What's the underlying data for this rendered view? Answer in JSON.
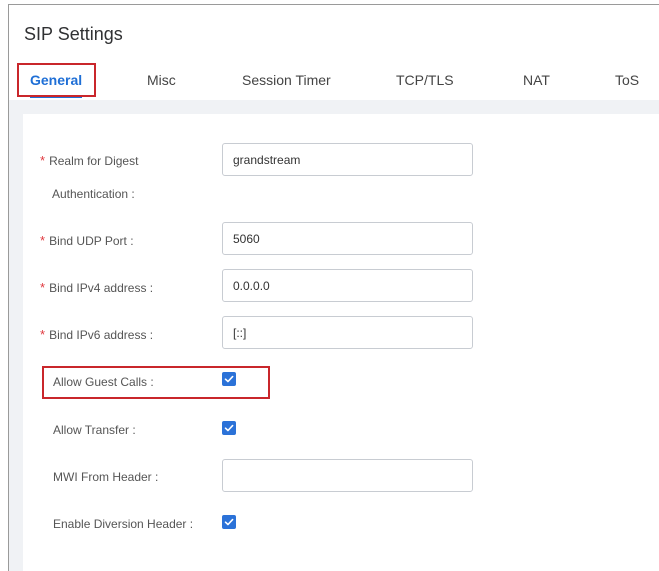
{
  "page": {
    "title": "SIP Settings"
  },
  "tabs": [
    {
      "label": "General",
      "active": true
    },
    {
      "label": "Misc",
      "active": false
    },
    {
      "label": "Session Timer",
      "active": false
    },
    {
      "label": "TCP/TLS",
      "active": false
    },
    {
      "label": "NAT",
      "active": false
    },
    {
      "label": "ToS",
      "active": false
    }
  ],
  "form": {
    "realm": {
      "label_line1": "Realm for Digest",
      "label_line2": "Authentication :",
      "value": "grandstream",
      "required": true
    },
    "udp_port": {
      "label": "Bind UDP Port :",
      "value": "5060",
      "required": true
    },
    "ipv4": {
      "label": "Bind IPv4 address :",
      "value": "0.0.0.0",
      "required": true
    },
    "ipv6": {
      "label": "Bind IPv6 address :",
      "value": "[::]",
      "required": true
    },
    "guest_calls": {
      "label": "Allow Guest Calls :",
      "checked": true
    },
    "transfer": {
      "label": "Allow Transfer :",
      "checked": true
    },
    "mwi": {
      "label": "MWI From Header :",
      "value": ""
    },
    "diversion": {
      "label": "Enable Diversion Header :",
      "checked": true
    }
  },
  "required_marker": "*",
  "colors": {
    "accent": "#1f6fd6",
    "checkbox": "#2b72d8",
    "highlight": "#c9262b",
    "required": "#e0383e"
  }
}
